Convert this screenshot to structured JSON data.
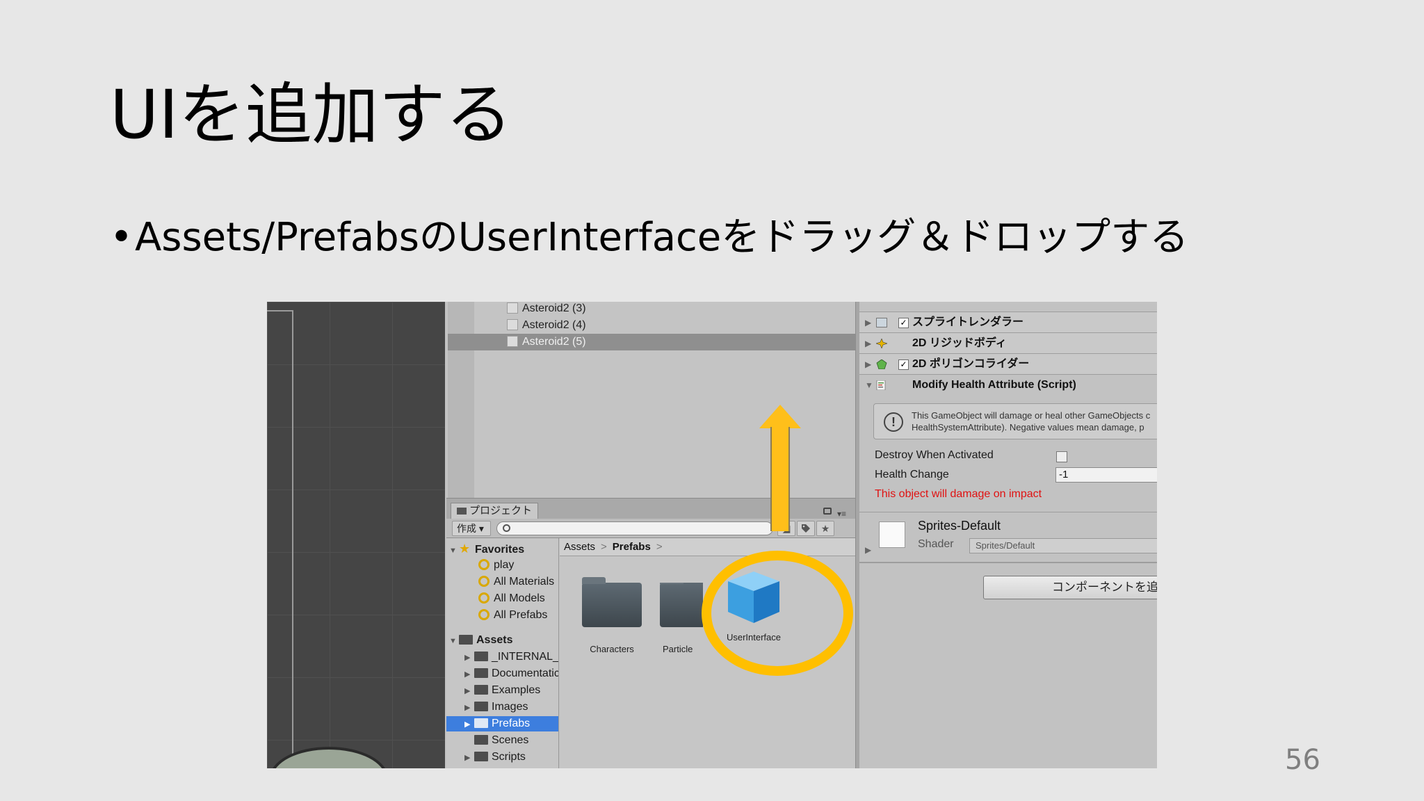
{
  "slide": {
    "title": "UIを追加する",
    "bullet_mark": "•",
    "bullet": "Assets/PrefabsのUserInterfaceをドラッグ＆ドロップする",
    "page_number": "56"
  },
  "hierarchy": {
    "items": [
      "Asteroid2 (3)",
      "Asteroid2 (4)",
      "Asteroid2 (5)"
    ],
    "selected": "Asteroid2 (5)"
  },
  "project": {
    "tab_label": "プロジェクト",
    "create_label": "作成 ▾",
    "menu_glyph": "▾≡",
    "toolbar_icons": [
      "◢",
      "tag-icon",
      "★"
    ],
    "favorites": {
      "label": "Favorites",
      "items": [
        "play",
        "All Materials",
        "All Models",
        "All Prefabs"
      ]
    },
    "assets": {
      "label": "Assets",
      "folders": [
        "_INTERNAL_",
        "Documentatic",
        "Examples",
        "Images",
        "Prefabs",
        "Scenes",
        "Scripts"
      ],
      "selected": "Prefabs"
    },
    "breadcrumb": [
      "Assets",
      "Prefabs"
    ],
    "breadcrumb_sep": ">",
    "items": [
      {
        "name": "Characters",
        "type": "folder"
      },
      {
        "name": "Particle",
        "type": "folder"
      },
      {
        "name": "UserInterface",
        "type": "prefab"
      }
    ]
  },
  "inspector": {
    "components": [
      {
        "name": "スプライトレンダラー",
        "checked": true,
        "icon": "sprite-renderer-icon",
        "expanded": false
      },
      {
        "name": "2D リジッドボディ",
        "checked": null,
        "icon": "rigidbody2d-icon",
        "expanded": false
      },
      {
        "name": "2D ポリゴンコライダー",
        "checked": true,
        "icon": "polygon-collider-icon",
        "expanded": false
      },
      {
        "name": "Modify Health Attribute (Script)",
        "checked": null,
        "icon": "script-icon",
        "expanded": true
      }
    ],
    "checkbox_mark": "✓",
    "help_icon": "!",
    "help_text_1": "This GameObject will damage or heal other GameObjects c",
    "help_text_2": "HealthSystemAttribute). Negative values mean damage, p",
    "destroy_label": "Destroy When Activated",
    "destroy_checked": false,
    "health_label": "Health Change",
    "health_value": "-1",
    "warning": "This object will damage on impact",
    "material_name": "Sprites-Default",
    "shader_label": "Shader",
    "shader_value": "Sprites/Default",
    "add_component": "コンポーネントを追加"
  },
  "colors": {
    "highlight": "#ffbf00",
    "warning": "#e01212",
    "selection": "#3d7ede"
  }
}
